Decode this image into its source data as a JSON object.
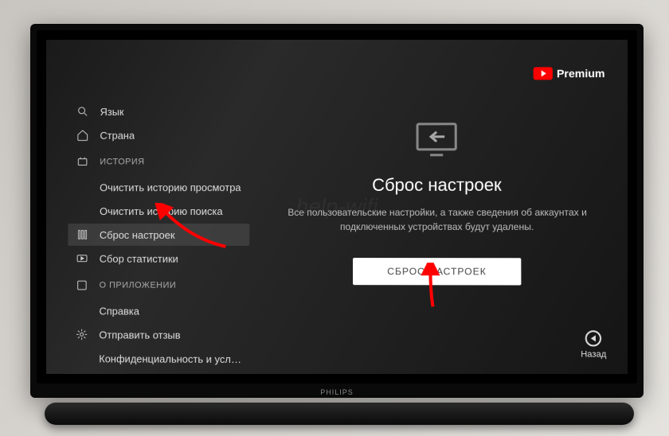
{
  "premium": {
    "label": "Premium"
  },
  "sidebar": {
    "items": [
      {
        "label": "Язык",
        "icon": "search-icon"
      },
      {
        "label": "Страна",
        "icon": "home-icon"
      },
      {
        "label": "ИСТОРИЯ",
        "icon": "history-icon",
        "header": true
      },
      {
        "label": "Очистить историю просмотра",
        "icon": null
      },
      {
        "label": "Очистить историю поиска",
        "icon": null
      },
      {
        "label": "Сброс настроек",
        "icon": "slider-icon",
        "selected": true
      },
      {
        "label": "Сбор статистики",
        "icon": "media-icon"
      },
      {
        "label": "О ПРИЛОЖЕНИИ",
        "icon": "about-icon",
        "header": true
      },
      {
        "label": "Справка",
        "icon": null
      },
      {
        "label": "Отправить отзыв",
        "icon": "gear-icon"
      },
      {
        "label": "Конфиденциальность и усло...",
        "icon": null
      }
    ]
  },
  "main": {
    "title": "Сброс настроек",
    "description": "Все пользовательские настройки, а также сведения об аккаунтах и подключенных устройствах будут удалены.",
    "button": "СБРОС НАСТРОЕК"
  },
  "back": {
    "label": "Назад"
  },
  "tv": {
    "brand": "PHILIPS"
  }
}
